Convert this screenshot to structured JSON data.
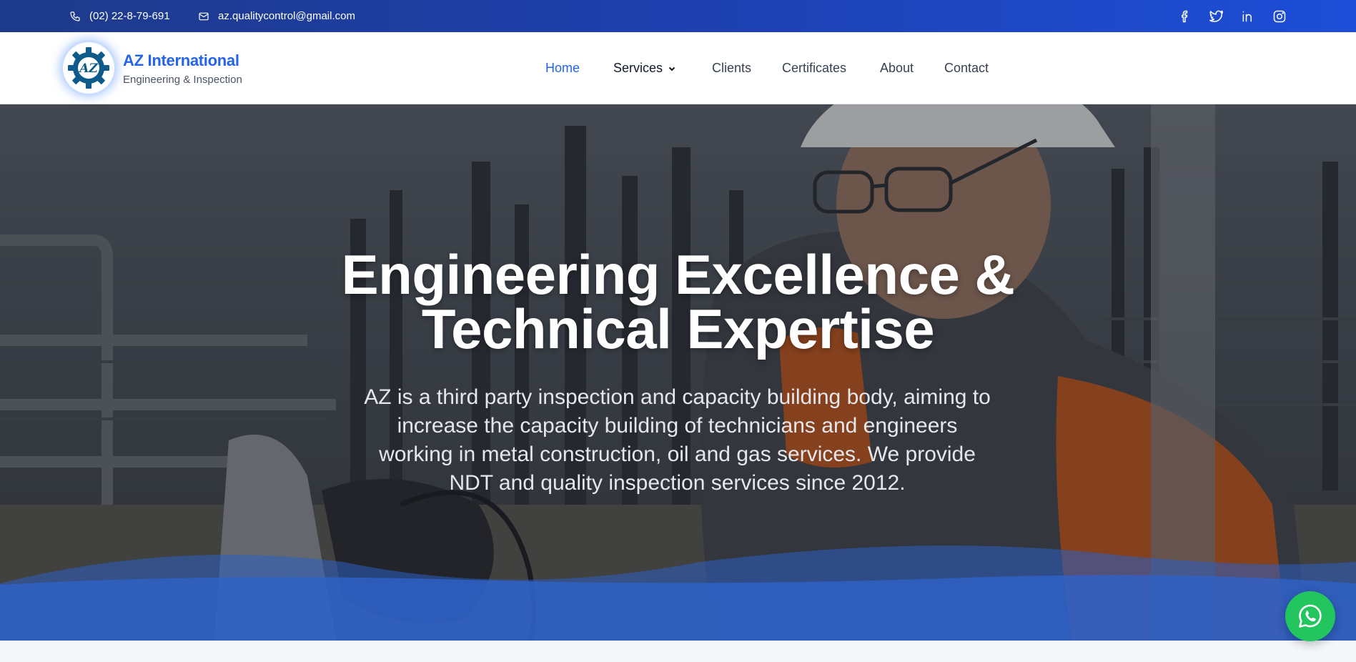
{
  "topbar": {
    "phone": "(02) 22-8-79-691",
    "email": "az.qualitycontrol@gmail.com",
    "icons": [
      "phone-icon",
      "mail-icon"
    ],
    "socials": [
      "facebook-icon",
      "twitter-icon",
      "linkedin-icon",
      "instagram-icon"
    ]
  },
  "brand": {
    "logo_text": "AZ",
    "name": "AZ International",
    "tagline": "Engineering & Inspection"
  },
  "nav": {
    "items": [
      "Home",
      "Services",
      "Clients",
      "Certificates",
      "About",
      "Contact"
    ],
    "active": "Home"
  },
  "hero": {
    "title_line1": "Engineering Excellence &",
    "title_line2": "Technical Expertise",
    "text_line1": "AZ is a third party inspection and capacity building body, aiming to",
    "text_line2": "increase the capacity building of technicians and engineers",
    "text_line3": "working in metal construction, oil and gas services. We provide",
    "text_line4": "NDT and quality inspection services since 2012."
  },
  "floating": {
    "whatsapp_icon": "whatsapp-icon"
  },
  "colors": {
    "topbar": "#1e40af",
    "brand": "#2563eb",
    "wave": "#2c5fc4",
    "whatsapp": "#22c55e"
  }
}
